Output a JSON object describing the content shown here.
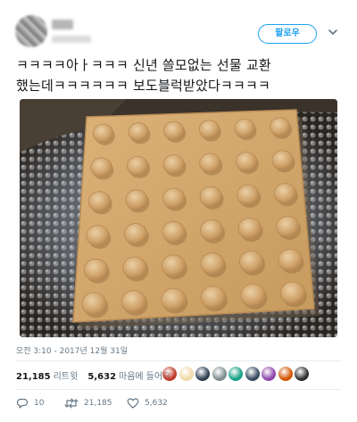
{
  "header": {
    "follow_label": "팔로우"
  },
  "tweet": {
    "line1": "ㅋㅋㅋㅋ아ㅏㅋㅋㅋ 신년 쓸모없는 선물 교환",
    "line2": "했는데ㅋㅋㅋㅋㅋㅋ 보도블럭받았다ㅋㅋㅋㅋ"
  },
  "meta": {
    "timestamp": "오전 3:10 - 2017년 12월 31일"
  },
  "stats": {
    "retweets_count": "21,185",
    "retweets_label": "리트윗",
    "likes_count": "5,632",
    "likes_label": "마음에 들어요"
  },
  "likers": [
    {
      "color": "#c0392b"
    },
    {
      "color": "#f0d9a8"
    },
    {
      "color": "#2c3e50"
    },
    {
      "color": "#7f8c8d"
    },
    {
      "color": "#16a085"
    },
    {
      "color": "#34495e"
    },
    {
      "color": "#8e44ad"
    },
    {
      "color": "#d35400"
    },
    {
      "color": "#2e2e2e"
    }
  ],
  "actions": {
    "reply_count": "10",
    "retweet_count": "21,185",
    "like_count": "5,632"
  },
  "colors": {
    "accent": "#1da1f2",
    "text": "#14171a",
    "muted": "#657786",
    "tile": "#d2a56a"
  }
}
